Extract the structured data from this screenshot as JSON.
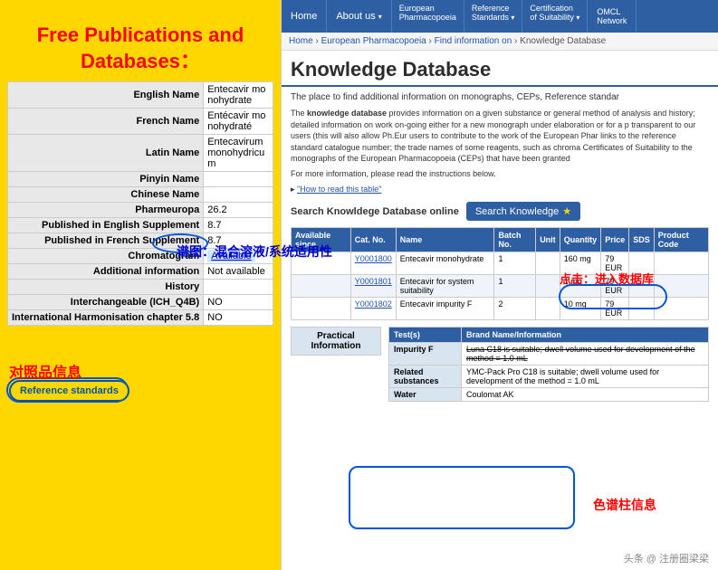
{
  "left": {
    "title_line1": "Free Publications and",
    "title_line2": "Databases：",
    "table_rows": [
      {
        "label": "English Name",
        "value": "Entecavir monohydrate"
      },
      {
        "label": "French Name",
        "value": "Entécavir monohydraté"
      },
      {
        "label": "Latin Name",
        "value": "Entecavirum monohydricum"
      },
      {
        "label": "Pinyin Name",
        "value": ""
      },
      {
        "label": "Chinese Name",
        "value": ""
      },
      {
        "label": "Pharmeuropa",
        "value": "26.2"
      },
      {
        "label": "Published in English Supplement",
        "value": "8.7"
      },
      {
        "label": "Published in French Supplement",
        "value": "8.7"
      },
      {
        "label": "Chromatogram",
        "value": "Available"
      },
      {
        "label": "Additional information",
        "value": "Not available"
      },
      {
        "label": "History",
        "value": ""
      },
      {
        "label": "Interchangeable (ICH_Q4B)",
        "value": "NO"
      },
      {
        "label": "International Harmonisation chapter 5.8",
        "value": "NO"
      }
    ],
    "annot_chrom": "谱图：混合溶液/系统适用性",
    "label_ref": "对照品信息",
    "label_ref_std": "Reference standards",
    "label_click": "点击：进入数据库",
    "label_col": "色谱柱信息"
  },
  "nav": {
    "home": "Home",
    "about": "About us",
    "about_arrow": "▾",
    "euro": "European Pharmacopoeia",
    "reference": "Reference Standards",
    "reference_arrow": "▾",
    "cert": "Certification of Suitability",
    "cert_arrow": "▾",
    "omcl": "OMCL Network"
  },
  "breadcrumb": {
    "items": [
      "Home",
      "European Pharmacopoeia",
      "Find information on",
      "Knowledge Database"
    ]
  },
  "page": {
    "title": "Knowledge Database",
    "desc1": "The place to find additional information on monographs, CEPs, Reference standar",
    "desc2": "The knowledge database provides information on a given substance or general method of analysis and history; detailed information on work on-going either for a new monograph under elaboration or for a p transparent to our users (this will also allow Ph.Eur users to contribute to the work of the European Phar links to the reference standard catalogue number; the trade names of some reagents, such as chroma Certificates of Suitability to the monographs of the European Pharmacopoeia (CEPs) that have been granted",
    "link_how": "\"How to read this table\"",
    "search_label": "Search Knowldege Database online",
    "search_btn": "Search Knowledge"
  },
  "data_table": {
    "headers": [
      "Available since",
      "Cat. No.",
      "Name",
      "Batch No.",
      "Unit",
      "Quantity",
      "Price",
      "SDS",
      "Product Code"
    ],
    "rows": [
      [
        "",
        "Y0001800",
        "Entecavir monohydrate",
        "1",
        "",
        "160 mg",
        "79 EUR",
        "",
        ""
      ],
      [
        "",
        "Y0001801",
        "Entecavir for system suitability",
        "1",
        "",
        "1 mg",
        "79 EUR",
        "",
        ""
      ],
      [
        "",
        "Y0001802",
        "Entecavir impurity F",
        "2",
        "",
        "10 mg",
        "79 EUR",
        "",
        ""
      ]
    ]
  },
  "pract_table": {
    "headers": [
      "Test(s)",
      "Brand Name/Information"
    ],
    "rows": [
      [
        "Impurity F",
        "Luna C18 is suitable; dwell volume used for development of the method = 1.0 mL"
      ],
      [
        "Related substances",
        "YMC-Pack Pro C18 is suitable; dwell volume used for development of the method = 1.0 mL"
      ],
      [
        "Water",
        "Coulomat AK"
      ]
    ]
  },
  "watermark": "头条 @ 注册圈梁梁"
}
